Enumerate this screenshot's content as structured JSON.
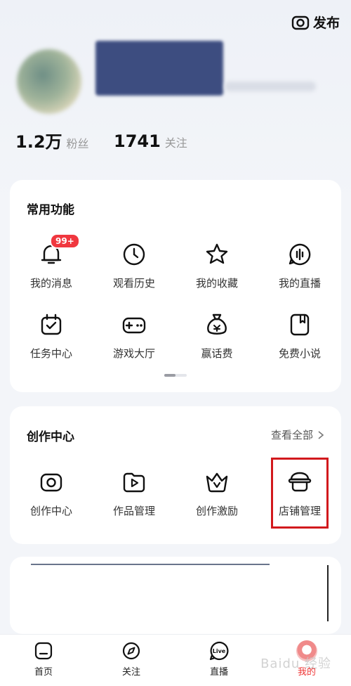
{
  "header": {
    "publish_label": "发布"
  },
  "profile": {
    "stats": [
      {
        "value": "1.2万",
        "label": "粉丝"
      },
      {
        "value": "1741",
        "label": "关注"
      }
    ]
  },
  "common": {
    "title": "常用功能",
    "items": [
      {
        "label": "我的消息",
        "icon": "bell-icon",
        "badge": "99+"
      },
      {
        "label": "观看历史",
        "icon": "clock-icon"
      },
      {
        "label": "我的收藏",
        "icon": "star-icon"
      },
      {
        "label": "我的直播",
        "icon": "live-icon"
      },
      {
        "label": "任务中心",
        "icon": "task-calendar-icon"
      },
      {
        "label": "游戏大厅",
        "icon": "gamepad-icon"
      },
      {
        "label": "赢话费",
        "icon": "money-bag-icon"
      },
      {
        "label": "免费小说",
        "icon": "book-icon"
      }
    ]
  },
  "create": {
    "title": "创作中心",
    "view_all": "查看全部",
    "items": [
      {
        "label": "创作中心",
        "icon": "camera-icon"
      },
      {
        "label": "作品管理",
        "icon": "video-folder-icon"
      },
      {
        "label": "创作激励",
        "icon": "crown-icon"
      },
      {
        "label": "店铺管理",
        "icon": "shop-icon"
      }
    ]
  },
  "nav": {
    "items": [
      {
        "label": "首页",
        "icon": "home-icon"
      },
      {
        "label": "关注",
        "icon": "compass-icon"
      },
      {
        "label": "直播",
        "icon": "live-tv-icon"
      },
      {
        "label": "我的",
        "icon": "profile-icon"
      }
    ]
  },
  "colors": {
    "accent": "#f0373f",
    "highlight_box": "#d2191d"
  },
  "watermark": "Baidu 经验"
}
